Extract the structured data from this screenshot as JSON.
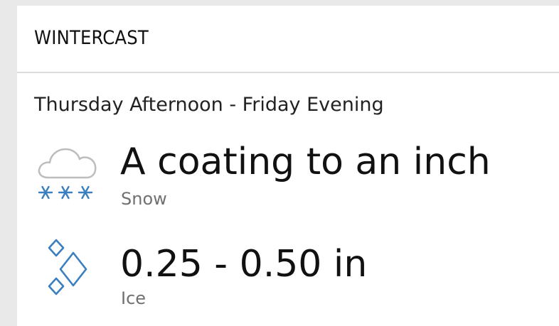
{
  "header": {
    "title": "WINTERCAST"
  },
  "forecast": {
    "period": "Thursday Afternoon - Friday Evening",
    "items": [
      {
        "icon": "snow-cloud-icon",
        "amount": "A coating to an inch",
        "type": "Snow",
        "icon_color": "#3a7fc0"
      },
      {
        "icon": "ice-diamonds-icon",
        "amount": "0.25 - 0.50 in",
        "type": "Ice",
        "icon_color": "#3a7fc0"
      }
    ]
  }
}
